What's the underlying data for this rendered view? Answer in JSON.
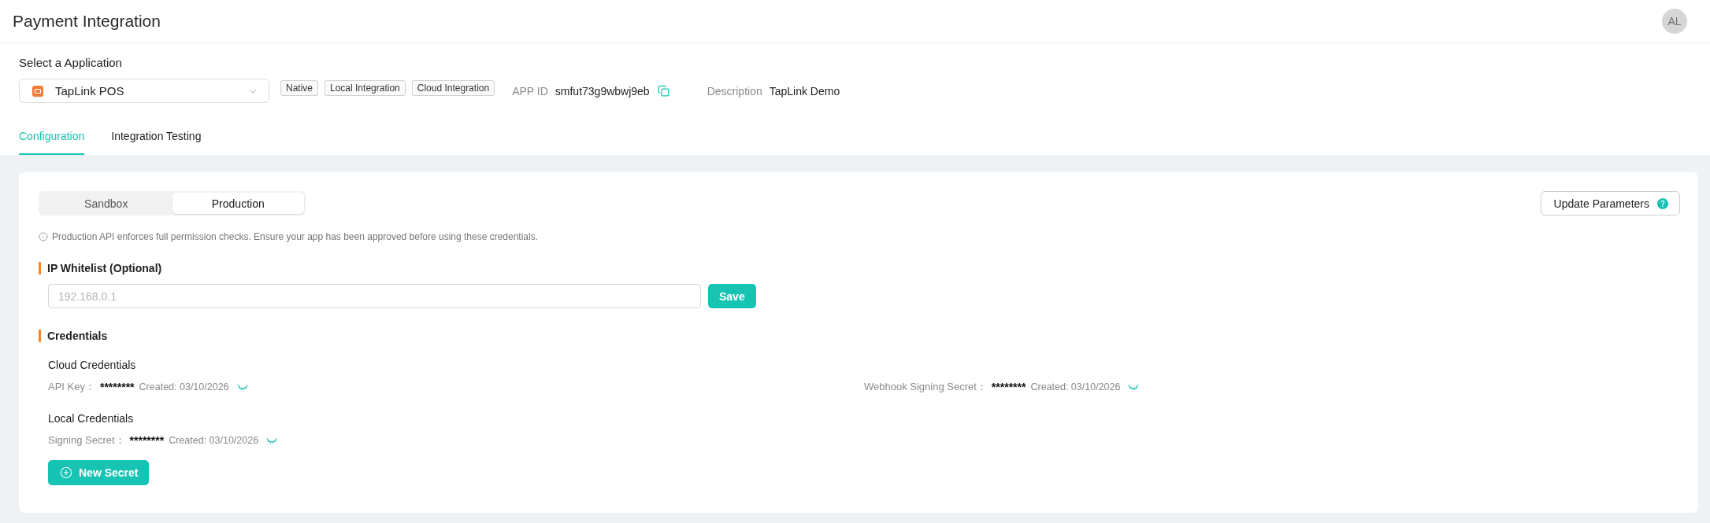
{
  "header": {
    "title": "Payment Integration",
    "avatar": "AL"
  },
  "application": {
    "label": "Select a Application",
    "selected_app": "TapLink POS",
    "tags": [
      "Native",
      "Local Integration",
      "Cloud Integration"
    ],
    "app_id_label": "APP ID",
    "app_id": "smfut73g9wbwj9eb",
    "description_label": "Description",
    "description": "TapLink Demo"
  },
  "tabs": [
    {
      "label": "Configuration",
      "selected": true
    },
    {
      "label": "Integration Testing",
      "selected": false
    }
  ],
  "environment": [
    {
      "label": "Sandbox",
      "selected": false
    },
    {
      "label": "Production",
      "selected": true
    }
  ],
  "update_button": "Update Parameters",
  "notice": "Production API enforces full permission checks. Ensure your app has been approved before using these credentials.",
  "ip_whitelist": {
    "title": "IP Whitelist (Optional)",
    "placeholder": "192.168.0.1",
    "button": "Save"
  },
  "credentials": {
    "title": "Credentials",
    "groups": [
      {
        "title": "Cloud Credentials",
        "items": [
          {
            "label": "API Key：",
            "value": "********",
            "created": "Created: 03/10/2026"
          },
          {
            "label": "Webhook Signing Secret：",
            "value": "********",
            "created": "Created: 03/10/2026"
          }
        ]
      },
      {
        "title": "Local Credentials",
        "items": [
          {
            "label": "Signing Secret：",
            "value": "********",
            "created": "Created: 03/10/2026"
          }
        ]
      }
    ],
    "new_button": "New Secret"
  }
}
